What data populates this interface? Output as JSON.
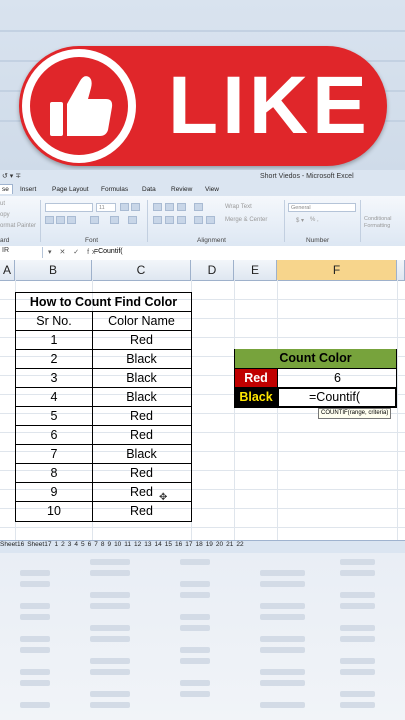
{
  "banner": {
    "like_text": "LIKE",
    "thumb_icon": "thumbs-up-icon"
  },
  "window": {
    "title": "Short Viedos - Microsoft Excel",
    "qat": "↺ ▾ ∓"
  },
  "ribbon": {
    "tabs": [
      "se",
      "Insert",
      "Page Layout",
      "Formulas",
      "Data",
      "Review",
      "View"
    ],
    "active_tab": "se",
    "clipboard_items": [
      "ut",
      "opy",
      "ormat Painter"
    ],
    "groups": [
      "ard",
      "Font",
      "Alignment",
      "Number"
    ],
    "font_size": "11",
    "wrap_text": "Wrap Text",
    "merge_center": "Merge & Center",
    "number_format": "General",
    "number_symbols": "% ,",
    "conditional_formatting": "Conditional Formatting"
  },
  "formula_bar": {
    "name_box": "IR",
    "icons": "▾ ✕ ✓ fx",
    "content": "=Countif("
  },
  "columns": [
    "A",
    "B",
    "C",
    "D",
    "E",
    "F"
  ],
  "selected_column": "F",
  "table": {
    "title": "How to Count Find Color",
    "headers": [
      "Sr No.",
      "Color Name"
    ],
    "rows": [
      [
        "1",
        "Red"
      ],
      [
        "2",
        "Black"
      ],
      [
        "3",
        "Black"
      ],
      [
        "4",
        "Black"
      ],
      [
        "5",
        "Red"
      ],
      [
        "6",
        "Red"
      ],
      [
        "7",
        "Black"
      ],
      [
        "8",
        "Red"
      ],
      [
        "9",
        "Red"
      ],
      [
        "10",
        "Red"
      ]
    ]
  },
  "count_box": {
    "header": "Count Color",
    "red_label": "Red",
    "red_value": "6",
    "black_label": "Black",
    "black_formula": "=Countif(",
    "tooltip": "COUNTIF(range, criteria)"
  },
  "sheet_tabs": [
    "Sheet16",
    "Sheet17",
    "1",
    "2",
    "3",
    "4",
    "5",
    "6",
    "7",
    "8",
    "9",
    "10",
    "11",
    "12",
    "13",
    "14",
    "15",
    "16",
    "17",
    "18",
    "19",
    "20",
    "21",
    "22"
  ],
  "colors": {
    "like_red": "#e0262a",
    "header_green": "#77a33c",
    "red_label": "#c00000",
    "black_label_text": "#ffe600",
    "selected_column": "#f7d58c"
  }
}
